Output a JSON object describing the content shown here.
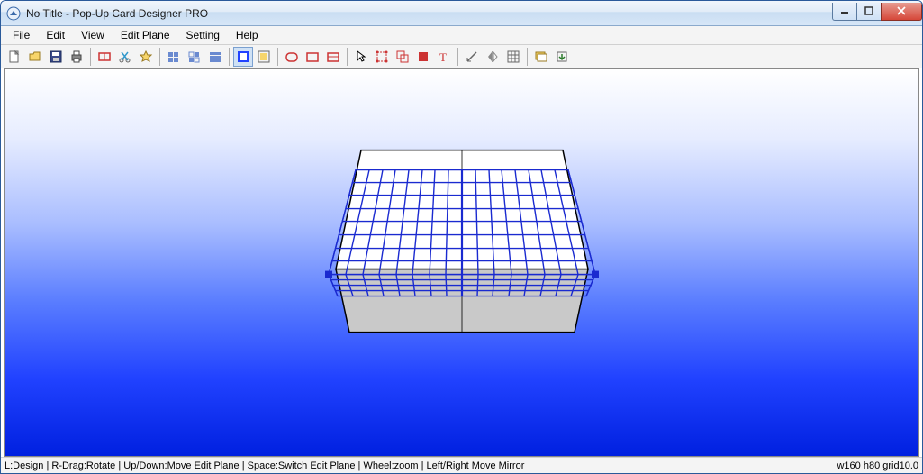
{
  "title": "No Title - Pop-Up Card Designer PRO",
  "menus": {
    "file": "File",
    "edit": "Edit",
    "view": "View",
    "editplane": "Edit Plane",
    "setting": "Setting",
    "help": "Help"
  },
  "status": {
    "left": "L:Design | R-Drag:Rotate | Up/Down:Move Edit Plane | Space:Switch Edit Plane | Wheel:zoom | Left/Right Move Mirror",
    "right": "w160 h80 grid10.0"
  },
  "toolbar_icons": [
    "new-file-icon",
    "open-file-icon",
    "save-icon",
    "print-icon",
    "sep",
    "card-outline-icon",
    "cut-icon",
    "favorite-icon",
    "sep",
    "grid-block-icon",
    "grid-block2-icon",
    "grid-strip-icon",
    "sep",
    "view-3d-icon",
    "view-flat-icon",
    "sep",
    "shape-rounded-icon",
    "shape-rect-icon",
    "shape-panel-icon",
    "sep",
    "select-icon",
    "selection-tool-icon",
    "group-icon",
    "red-panel-icon",
    "text-tool-icon",
    "sep",
    "measure-icon",
    "mirror-icon",
    "grid-settings-icon",
    "sep",
    "layers-icon",
    "export-icon"
  ]
}
